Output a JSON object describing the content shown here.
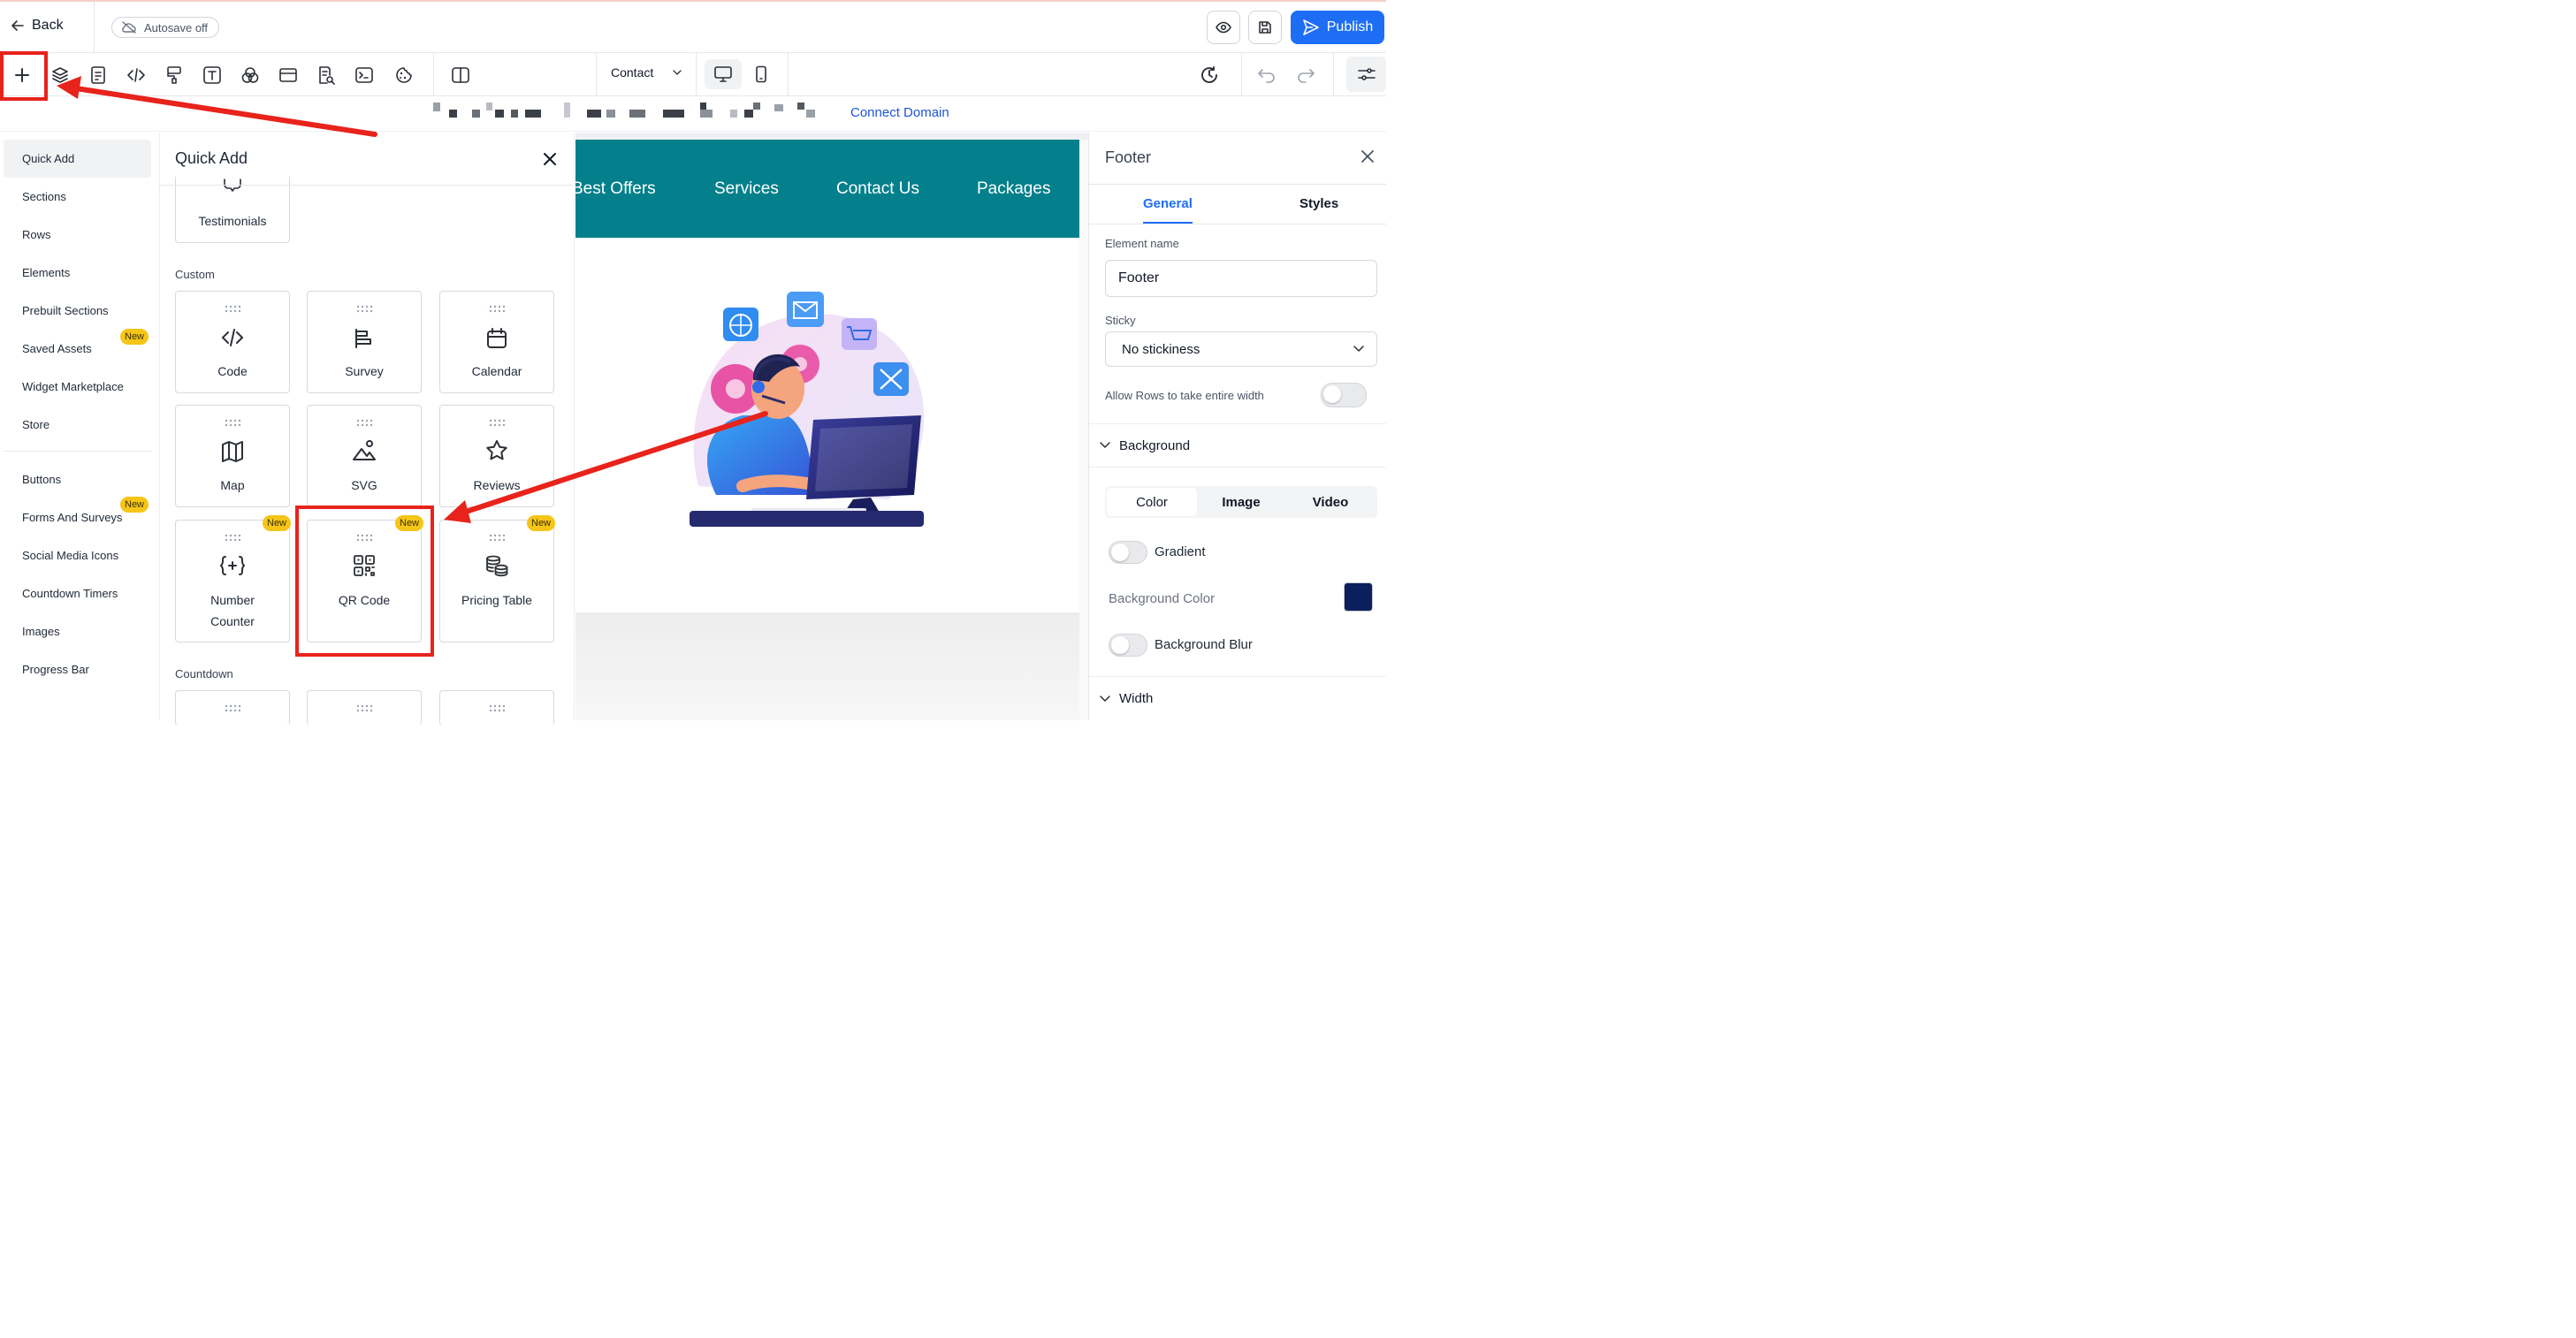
{
  "header": {
    "back_label": "Back",
    "autosave_label": "Autosave off",
    "publish_label": "Publish"
  },
  "toolbar": {
    "icons": [
      "add-icon",
      "layers-icon",
      "page-icon",
      "code-icon",
      "paint-icon",
      "text-icon",
      "color-icon",
      "section-icon",
      "seo-icon",
      "terminal-icon",
      "cookie-icon",
      "split-view-icon"
    ],
    "page_select_value": "Contact"
  },
  "domain_bar": {
    "connect_label": "Connect Domain"
  },
  "left_nav": {
    "items": [
      {
        "label": "Quick Add"
      },
      {
        "label": "Sections"
      },
      {
        "label": "Rows"
      },
      {
        "label": "Elements"
      },
      {
        "label": "Prebuilt Sections"
      },
      {
        "label": "Saved Assets",
        "badge": "New"
      },
      {
        "label": "Widget Marketplace"
      },
      {
        "label": "Store"
      },
      {
        "label": "Buttons"
      },
      {
        "label": "Forms And Surveys",
        "badge": "New"
      },
      {
        "label": "Social Media Icons"
      },
      {
        "label": "Countdown Timers"
      },
      {
        "label": "Images"
      },
      {
        "label": "Progress Bar"
      }
    ]
  },
  "quick_add": {
    "title": "Quick Add",
    "top_card": "Testimonials",
    "custom_label": "Custom",
    "cards": [
      {
        "label": "Code",
        "icon": "code-icon"
      },
      {
        "label": "Survey",
        "icon": "survey-icon"
      },
      {
        "label": "Calendar",
        "icon": "calendar-icon"
      },
      {
        "label": "Map",
        "icon": "map-icon"
      },
      {
        "label": "SVG",
        "icon": "image-icon"
      },
      {
        "label": "Reviews",
        "icon": "star-icon"
      },
      {
        "label_line1": "Number",
        "label_line2": "Counter",
        "icon": "number-counter-icon",
        "badge": "New"
      },
      {
        "label": "QR Code",
        "icon": "qr-code-icon",
        "badge": "New"
      },
      {
        "label": "Pricing Table",
        "icon": "pricing-table-icon",
        "badge": "New"
      }
    ],
    "countdown_label": "Countdown"
  },
  "canvas": {
    "nav_items": [
      "Best Offers",
      "Services",
      "Contact Us",
      "Packages"
    ],
    "teal_color": "#03808b"
  },
  "right_panel": {
    "title": "Footer",
    "tab_general": "General",
    "tab_styles": "Styles",
    "element_name_label": "Element name",
    "element_name_value": "Footer",
    "sticky_label": "Sticky",
    "sticky_value": "No stickiness",
    "allow_rows_label": "Allow Rows to take entire width",
    "background_label": "Background",
    "bg_tabs": [
      "Color",
      "Image",
      "Video"
    ],
    "gradient_label": "Gradient",
    "bg_color_label": "Background Color",
    "bg_color_value": "#0b1f5c",
    "bg_blur_label": "Background Blur",
    "width_label": "Width"
  },
  "colors": {
    "accent": "#1d6ef5",
    "annotation": "#e8231b",
    "badge": "#f5c518"
  }
}
